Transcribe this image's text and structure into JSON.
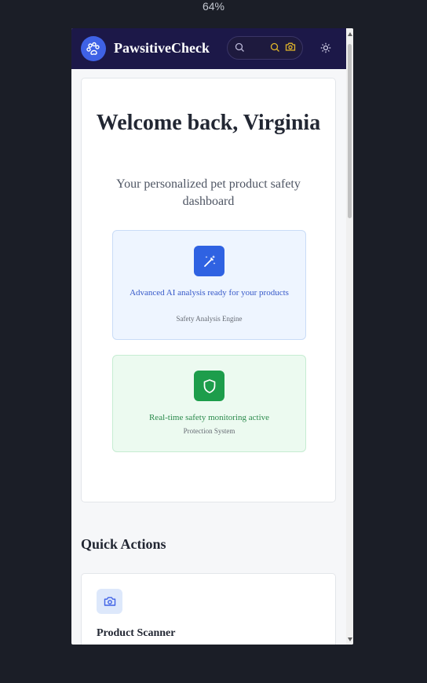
{
  "browser": {
    "zoom": "64%"
  },
  "header": {
    "brand": "PawsitiveCheck",
    "icons": [
      "paw-icon",
      "search-icon",
      "search-icon",
      "camera-icon",
      "sun-icon"
    ]
  },
  "welcome": {
    "title": "Welcome back, Virginia",
    "subtitle": "Your personalized pet product safety dashboard"
  },
  "features": [
    {
      "text": "Advanced AI analysis ready for your products",
      "caption": "Safety Analysis Engine",
      "icon": "magic-wand-icon",
      "color": "#2f62e2"
    },
    {
      "text": "Real-time safety monitoring active",
      "caption": "Protection System",
      "icon": "shield-icon",
      "color": "#1d9d4b"
    }
  ],
  "quick_actions": {
    "title": "Quick Actions",
    "items": [
      {
        "label": "Product Scanner",
        "icon": "camera-icon"
      }
    ]
  },
  "colors": {
    "header_bg": "#1c1848",
    "accent_blue": "#3f62e6",
    "accent_green": "#1d9d4b"
  }
}
